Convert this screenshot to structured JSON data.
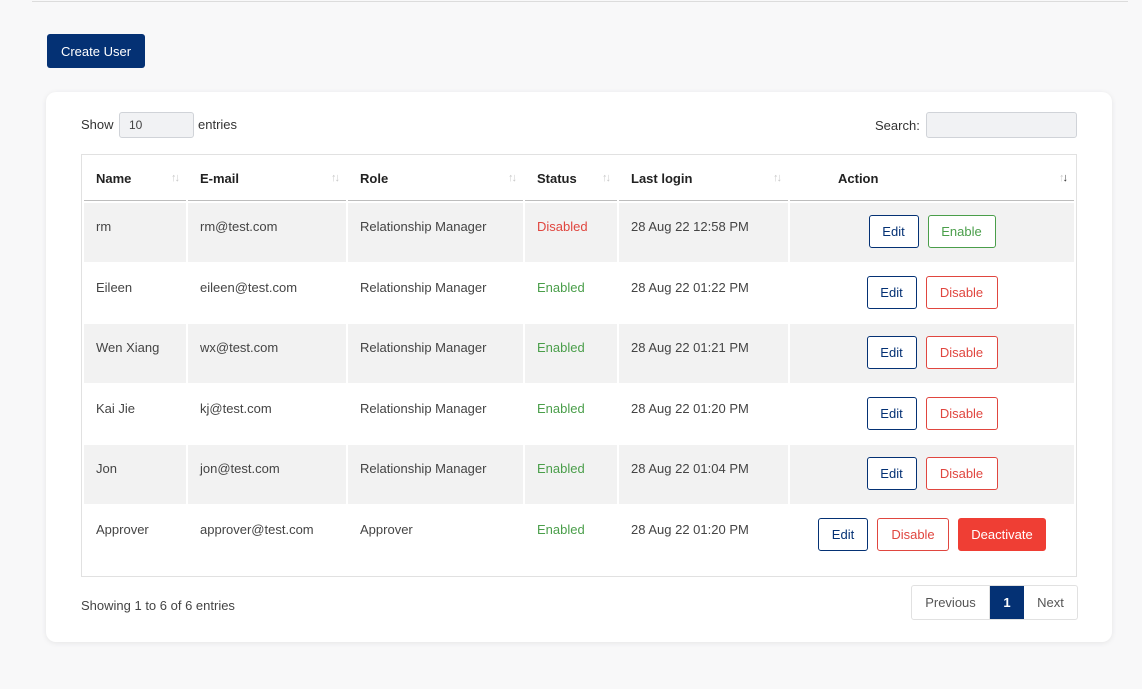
{
  "toolbar": {
    "create_user_label": "Create User"
  },
  "table_controls": {
    "show_label": "Show",
    "entries_value": "10",
    "entries_suffix": "entries",
    "search_label": "Search:",
    "search_value": ""
  },
  "table": {
    "columns": [
      "Name",
      "E-mail",
      "Role",
      "Status",
      "Last login",
      "Action"
    ],
    "rows": [
      {
        "name": "rm",
        "email": "rm@test.com",
        "role": "Relationship Manager",
        "status": "Disabled",
        "last_login": "28 Aug 22 12:58 PM"
      },
      {
        "name": "Eileen",
        "email": "eileen@test.com",
        "role": "Relationship Manager",
        "status": "Enabled",
        "last_login": "28 Aug 22 01:22 PM"
      },
      {
        "name": "Wen Xiang",
        "email": "wx@test.com",
        "role": "Relationship Manager",
        "status": "Enabled",
        "last_login": "28 Aug 22 01:21 PM"
      },
      {
        "name": "Kai Jie",
        "email": "kj@test.com",
        "role": "Relationship Manager",
        "status": "Enabled",
        "last_login": "28 Aug 22 01:20 PM"
      },
      {
        "name": "Jon",
        "email": "jon@test.com",
        "role": "Relationship Manager",
        "status": "Enabled",
        "last_login": "28 Aug 22 01:04 PM"
      },
      {
        "name": "Approver",
        "email": "approver@test.com",
        "role": "Approver",
        "status": "Enabled",
        "last_login": "28 Aug 22 01:20 PM"
      }
    ],
    "action_labels": {
      "edit": "Edit",
      "enable": "Enable",
      "disable": "Disable",
      "deactivate": "Deactivate"
    }
  },
  "footer": {
    "info": "Showing 1 to 6 of 6 entries",
    "pagination": {
      "previous": "Previous",
      "current_page": "1",
      "next": "Next"
    }
  },
  "colors": {
    "primary": "#043174",
    "enabled": "#4a9e4a",
    "disabled": "#e0463f",
    "deactivate": "#ef3e34"
  }
}
